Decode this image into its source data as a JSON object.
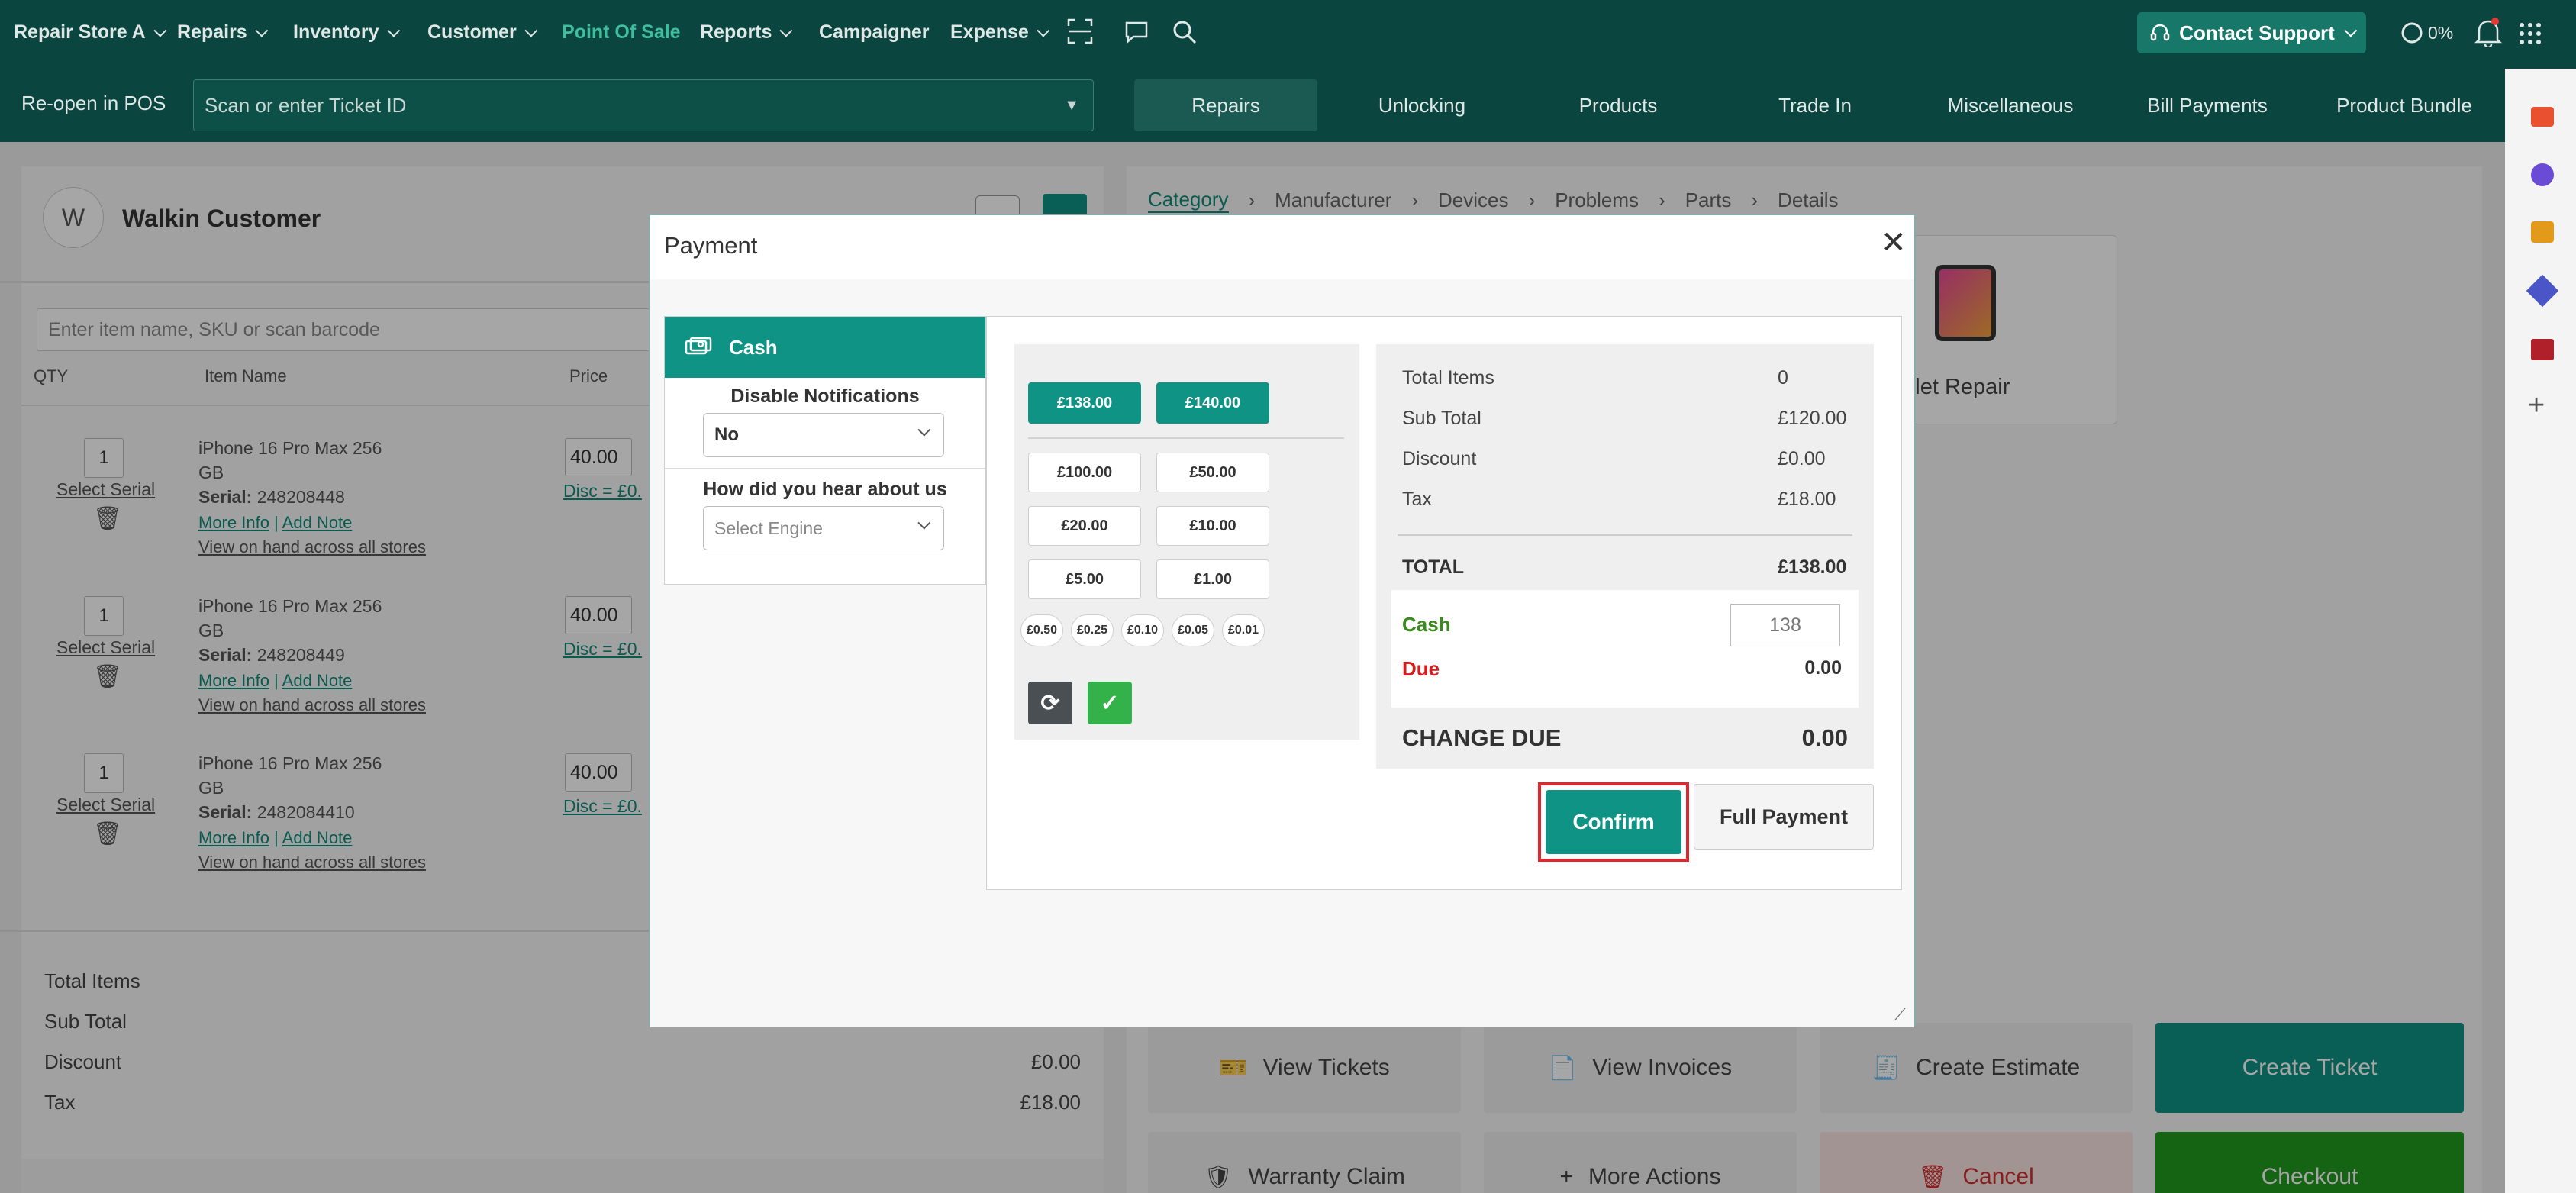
{
  "nav": {
    "store": "Repair Store A",
    "items": [
      "Repairs",
      "Inventory",
      "Customer",
      "Point Of Sale",
      "Reports",
      "Campaigner",
      "Expense"
    ],
    "support": "Contact Support",
    "progress": "0%"
  },
  "subnav": {
    "reopen": "Re-open in POS",
    "scan_placeholder": "Scan or enter Ticket ID",
    "tabs": [
      "Repairs",
      "Unlocking",
      "Products",
      "Trade In",
      "Miscellaneous",
      "Bill Payments",
      "Product Bundle"
    ]
  },
  "customer": {
    "avatar": "W",
    "name": "Walkin Customer"
  },
  "cart": {
    "search_placeholder": "Enter item name, SKU or scan barcode",
    "headers": {
      "qty": "QTY",
      "name": "Item Name",
      "price": "Price"
    },
    "items": [
      {
        "qty": "1",
        "select_serial": "Select Serial",
        "name1": "iPhone 16 Pro Max 256",
        "name2": "GB",
        "serial_label": "Serial:",
        "serial": "248208448",
        "more_info": "More Info",
        "add_note": "Add Note",
        "view_stores": "View on hand across all stores",
        "price": "40.00",
        "disc": "Disc = £0."
      },
      {
        "qty": "1",
        "select_serial": "Select Serial",
        "name1": "iPhone 16 Pro Max 256",
        "name2": "GB",
        "serial_label": "Serial:",
        "serial": "248208449",
        "more_info": "More Info",
        "add_note": "Add Note",
        "view_stores": "View on hand across all stores",
        "price": "40.00",
        "disc": "Disc = £0."
      },
      {
        "qty": "1",
        "select_serial": "Select Serial",
        "name1": "iPhone 16 Pro Max 256",
        "name2": "GB",
        "serial_label": "Serial:",
        "serial": "2482084410",
        "more_info": "More Info",
        "add_note": "Add Note",
        "view_stores": "View on hand across all stores",
        "price": "40.00",
        "disc": "Disc = £0."
      }
    ]
  },
  "summary": {
    "total_items": "Total Items",
    "sub_total": "Sub Total",
    "discount": "Discount",
    "discount_value": "£0.00",
    "tax": "Tax",
    "tax_value": "£18.00"
  },
  "breadcrumb": [
    "Category",
    "Manufacturer",
    "Devices",
    "Problems",
    "Parts",
    "Details"
  ],
  "tile": {
    "label": "ablet Repair"
  },
  "actions": {
    "view_tickets": "View Tickets",
    "view_invoices": "View Invoices",
    "create_estimate": "Create Estimate",
    "create_ticket": "Create Ticket",
    "warranty": "Warranty Claim",
    "more_actions": "More Actions",
    "cancel": "Cancel",
    "checkout": "Checkout"
  },
  "payment": {
    "title": "Payment",
    "method": "Cash",
    "disable_notifications": "Disable Notifications",
    "notif_value": "No",
    "hear_about": "How did you hear about us",
    "hear_placeholder": "Select Engine",
    "quick": [
      "£138.00",
      "£140.00"
    ],
    "notes": [
      "£100.00",
      "£50.00",
      "£20.00",
      "£10.00",
      "£5.00",
      "£1.00"
    ],
    "coins": [
      "£0.50",
      "£0.25",
      "£0.10",
      "£0.05",
      "£0.01"
    ],
    "total_items_label": "Total Items",
    "total_items_value": "0",
    "sub_total_label": "Sub Total",
    "sub_total_value": "£120.00",
    "discount_label": "Discount",
    "discount_value": "£0.00",
    "tax_label": "Tax",
    "tax_value": "£18.00",
    "total_label": "TOTAL",
    "total_value": "£138.00",
    "cash_label": "Cash",
    "cash_value": "138",
    "due_label": "Due",
    "due_value": "0.00",
    "change_label": "CHANGE DUE",
    "change_value": "0.00",
    "confirm": "Confirm",
    "full_payment": "Full Payment"
  },
  "colors": {
    "nav_bg": "#0b4540",
    "accent": "#0f9384",
    "active_nav": "#3dbf9d",
    "due_red": "#d81b1b",
    "cash_green": "#3a8a1e",
    "highlight": "#e0262e"
  }
}
